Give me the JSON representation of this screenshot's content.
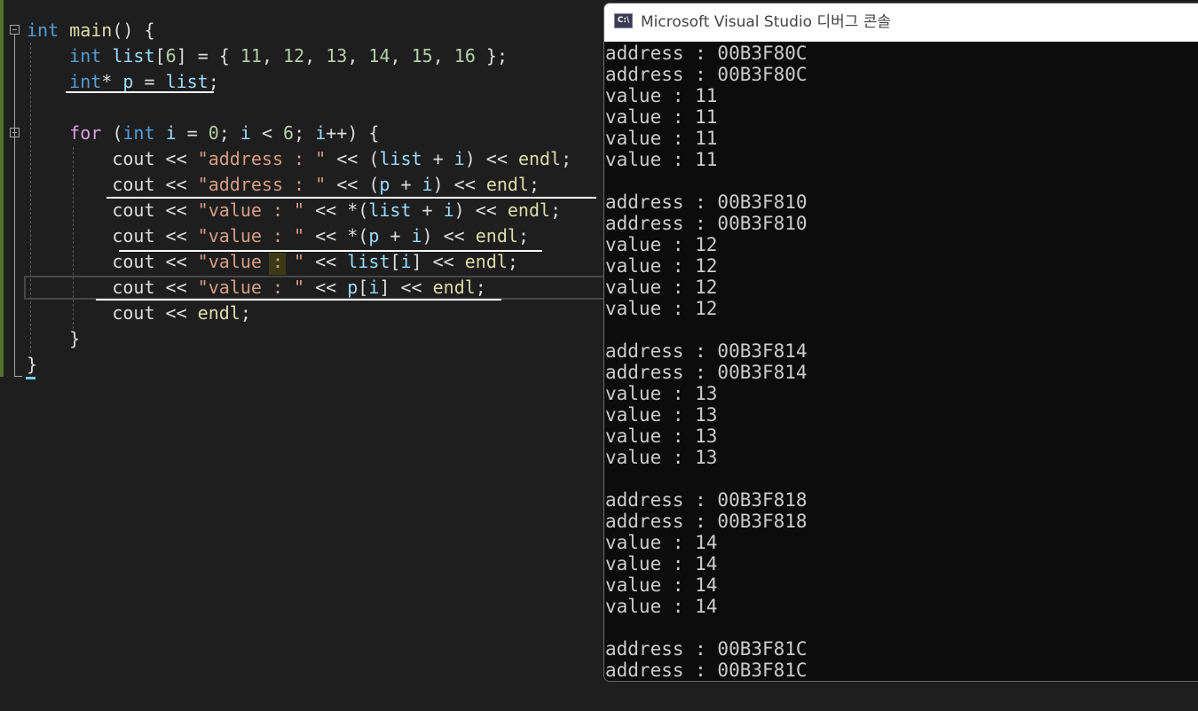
{
  "editor": {
    "lines": [
      {
        "tokens": [
          {
            "t": "int",
            "c": "kw"
          },
          {
            "t": " "
          },
          {
            "t": "main",
            "c": "fn"
          },
          {
            "t": "() {"
          }
        ]
      },
      {
        "tokens": [
          {
            "t": "    "
          },
          {
            "t": "int",
            "c": "kw"
          },
          {
            "t": " "
          },
          {
            "t": "list",
            "c": "var"
          },
          {
            "t": "["
          },
          {
            "t": "6",
            "c": "num"
          },
          {
            "t": "] = { "
          },
          {
            "t": "11",
            "c": "num"
          },
          {
            "t": ", "
          },
          {
            "t": "12",
            "c": "num"
          },
          {
            "t": ", "
          },
          {
            "t": "13",
            "c": "num"
          },
          {
            "t": ", "
          },
          {
            "t": "14",
            "c": "num"
          },
          {
            "t": ", "
          },
          {
            "t": "15",
            "c": "num"
          },
          {
            "t": ", "
          },
          {
            "t": "16",
            "c": "num"
          },
          {
            "t": " };"
          }
        ]
      },
      {
        "tokens": [
          {
            "t": "    "
          },
          {
            "t": "int",
            "c": "kw"
          },
          {
            "t": "* "
          },
          {
            "t": "p",
            "c": "var"
          },
          {
            "t": " = "
          },
          {
            "t": "list",
            "c": "var"
          },
          {
            "t": ";"
          }
        ]
      },
      {
        "tokens": []
      },
      {
        "tokens": [
          {
            "t": "    "
          },
          {
            "t": "for",
            "c": "kw2"
          },
          {
            "t": " ("
          },
          {
            "t": "int",
            "c": "kw"
          },
          {
            "t": " "
          },
          {
            "t": "i",
            "c": "var"
          },
          {
            "t": " = "
          },
          {
            "t": "0",
            "c": "num"
          },
          {
            "t": "; "
          },
          {
            "t": "i",
            "c": "var"
          },
          {
            "t": " < "
          },
          {
            "t": "6",
            "c": "num"
          },
          {
            "t": "; "
          },
          {
            "t": "i",
            "c": "var"
          },
          {
            "t": "++) {"
          }
        ]
      },
      {
        "tokens": [
          {
            "t": "        cout << "
          },
          {
            "t": "\"address : \"",
            "c": "str"
          },
          {
            "t": " << ("
          },
          {
            "t": "list",
            "c": "var"
          },
          {
            "t": " + "
          },
          {
            "t": "i",
            "c": "var"
          },
          {
            "t": ") << "
          },
          {
            "t": "endl",
            "c": "fn"
          },
          {
            "t": ";"
          }
        ]
      },
      {
        "tokens": [
          {
            "t": "        cout << "
          },
          {
            "t": "\"address : \"",
            "c": "str"
          },
          {
            "t": " << ("
          },
          {
            "t": "p",
            "c": "var"
          },
          {
            "t": " + "
          },
          {
            "t": "i",
            "c": "var"
          },
          {
            "t": ") << "
          },
          {
            "t": "endl",
            "c": "fn"
          },
          {
            "t": ";"
          }
        ]
      },
      {
        "tokens": [
          {
            "t": "        cout << "
          },
          {
            "t": "\"value : \"",
            "c": "str"
          },
          {
            "t": " << *("
          },
          {
            "t": "list",
            "c": "var"
          },
          {
            "t": " + "
          },
          {
            "t": "i",
            "c": "var"
          },
          {
            "t": ") << "
          },
          {
            "t": "endl",
            "c": "fn"
          },
          {
            "t": ";"
          }
        ]
      },
      {
        "tokens": [
          {
            "t": "        cout << "
          },
          {
            "t": "\"value : \"",
            "c": "str"
          },
          {
            "t": " << *("
          },
          {
            "t": "p",
            "c": "var"
          },
          {
            "t": " + "
          },
          {
            "t": "i",
            "c": "var"
          },
          {
            "t": ") << "
          },
          {
            "t": "endl",
            "c": "fn"
          },
          {
            "t": ";"
          }
        ]
      },
      {
        "tokens": [
          {
            "t": "        cout << "
          },
          {
            "t": "\"value : \"",
            "c": "str"
          },
          {
            "t": " << "
          },
          {
            "t": "list",
            "c": "var"
          },
          {
            "t": "["
          },
          {
            "t": "i",
            "c": "var"
          },
          {
            "t": "] << "
          },
          {
            "t": "endl",
            "c": "fn"
          },
          {
            "t": ";"
          }
        ]
      },
      {
        "tokens": [
          {
            "t": "        cout << "
          },
          {
            "t": "\"value : \"",
            "c": "str"
          },
          {
            "t": " << "
          },
          {
            "t": "p",
            "c": "var"
          },
          {
            "t": "["
          },
          {
            "t": "i",
            "c": "var"
          },
          {
            "t": "] << "
          },
          {
            "t": "endl",
            "c": "fn"
          },
          {
            "t": ";"
          }
        ]
      },
      {
        "tokens": [
          {
            "t": "        cout << "
          },
          {
            "t": "endl",
            "c": "fn"
          },
          {
            "t": ";"
          }
        ]
      },
      {
        "tokens": [
          {
            "t": "    }"
          }
        ]
      },
      {
        "tokens": [
          {
            "t": "}"
          }
        ]
      }
    ]
  },
  "console": {
    "title": "Microsoft Visual Studio 디버그 콘솔",
    "icon": "c-sharp-console-icon",
    "output": [
      "address : 00B3F80C",
      "address : 00B3F80C",
      "value : 11",
      "value : 11",
      "value : 11",
      "value : 11",
      "",
      "address : 00B3F810",
      "address : 00B3F810",
      "value : 12",
      "value : 12",
      "value : 12",
      "value : 12",
      "",
      "address : 00B3F814",
      "address : 00B3F814",
      "value : 13",
      "value : 13",
      "value : 13",
      "value : 13",
      "",
      "address : 00B3F818",
      "address : 00B3F818",
      "value : 14",
      "value : 14",
      "value : 14",
      "value : 14",
      "",
      "address : 00B3F81C",
      "address : 00B3F81C"
    ]
  }
}
